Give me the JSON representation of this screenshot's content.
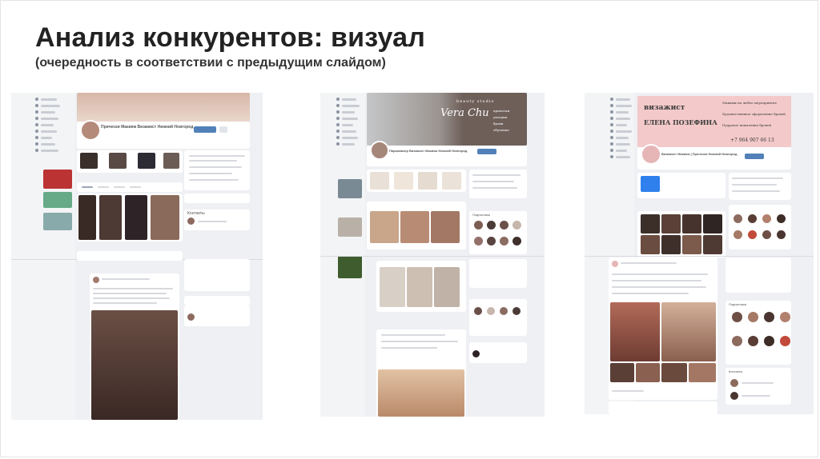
{
  "slide": {
    "title": "Анализ конкурентов: визуал",
    "subtitle": "(очередность в соответствии с предыдущим слайдом)"
  },
  "screenshots": [
    {
      "profile_name": "Прически Макияж Визажист Нижний Новгород",
      "contacts_label": "Контакты"
    },
    {
      "cover_brand": "Vera Chu",
      "cover_tagline": "beauty studio",
      "cover_services": [
        "прически",
        "укладки",
        "брови",
        "обучение"
      ],
      "profile_name": "Парикмахер Визажист Макияж Нижний Новгород",
      "followers_label": "Подписчики"
    },
    {
      "cover_line1": "визажист",
      "cover_line2": "ЕЛЕНА ПОЗЕФИНА",
      "cover_services": [
        "Макияж на любое мероприятие",
        "Художественное оформление бровей",
        "Пудровое напыление бровей"
      ],
      "cover_phone": "+7 964 907 66 13",
      "profile_name": "Визажист Макияж | Прическа Нижний Новгород",
      "followers_label": "Подписчики",
      "contacts_label": "Контакты"
    }
  ],
  "colors": {
    "accent": "#5181b8",
    "pink": "#f3c9c9",
    "dark_cover": "#6e5f59"
  }
}
